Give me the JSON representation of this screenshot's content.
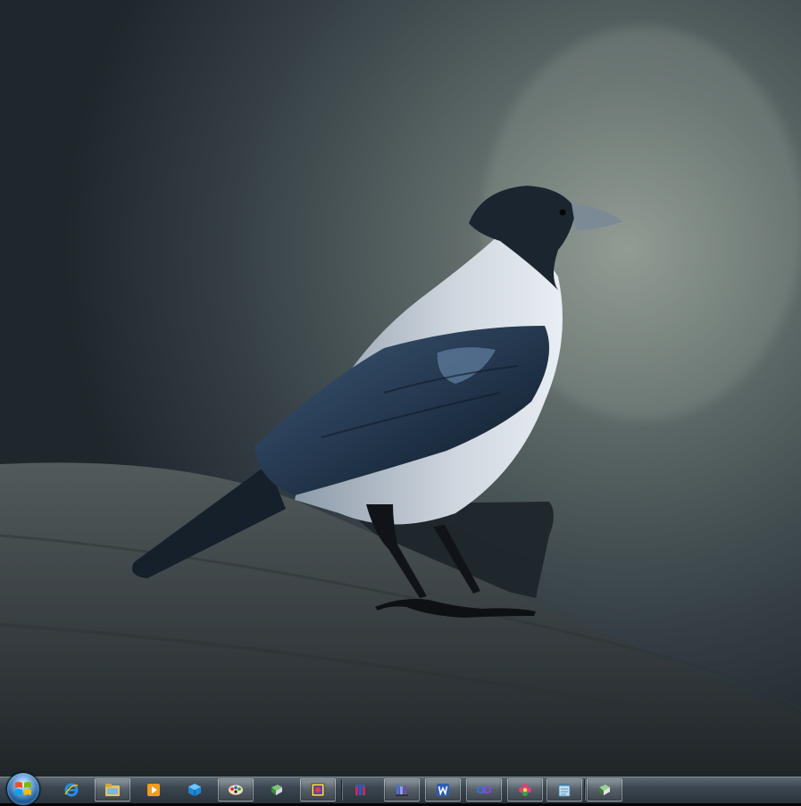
{
  "taskbar": {
    "start_icon": "windows-start-orb",
    "buttons": [
      {
        "name": "internet-explorer-icon",
        "active": false
      },
      {
        "name": "windows-explorer-icon",
        "active": true
      },
      {
        "name": "media-player-icon",
        "active": false
      },
      {
        "name": "3d-app-icon",
        "active": false
      },
      {
        "name": "paint-app-icon",
        "active": true
      },
      {
        "name": "green-book-icon",
        "active": false
      },
      {
        "name": "photo-viewer-icon",
        "active": true
      },
      {
        "name": "pen-app-icon",
        "active": false
      },
      {
        "name": "books-library-icon",
        "active": true
      },
      {
        "name": "word-icon",
        "active": true
      },
      {
        "name": "link-app-icon",
        "active": true
      },
      {
        "name": "flower-app-icon",
        "active": true
      },
      {
        "name": "notepad-icon",
        "active": true
      },
      {
        "name": "book-app-icon",
        "active": true
      }
    ]
  },
  "colors": {
    "taskbar_top": "#5b6872",
    "taskbar_bottom": "#2a333b",
    "wallpaper_bg": "#3d474d",
    "crow_wing": "#2e4257",
    "crow_body": "#c8ced6"
  }
}
